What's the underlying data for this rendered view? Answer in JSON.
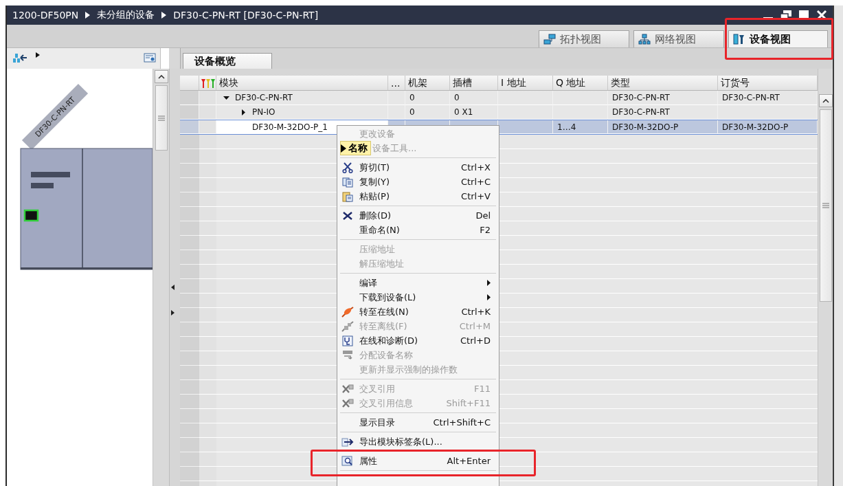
{
  "window": {
    "breadcrumb": [
      "1200-DF50PN",
      "未分组的设备",
      "DF30-C-PN-RT [DF30-C-PN-RT]"
    ]
  },
  "view_tabs": [
    {
      "label": "拓扑视图",
      "selected": false
    },
    {
      "label": "网络视图",
      "selected": false
    },
    {
      "label": "设备视图",
      "selected": true
    }
  ],
  "device_panel": {
    "device_label": "DF30-C-PN-RT"
  },
  "overview_tab": {
    "label": "设备概览",
    "selected": true
  },
  "table": {
    "columns": [
      "模块",
      "...",
      "机架",
      "插槽",
      "I 地址",
      "Q 地址",
      "类型",
      "订货号"
    ],
    "rows": [
      {
        "module": "DF30-C-PN-RT",
        "expanded": true,
        "selected": false,
        "rack": "0",
        "slot": "0",
        "type": "DF30-C-PN-RT",
        "order_no": "DF30-C-PN-RT",
        "children": [
          {
            "module": "PN-IO",
            "expanded": false,
            "selected": false,
            "rack": "0",
            "slot": "0 X1",
            "type": "DF30-C-PN-RT"
          },
          {
            "module": "DF30-M-32DO-P_1",
            "selected": true,
            "q_address": "1…4",
            "type": "DF30-M-32DO-P",
            "order_no": "DF30-M-32DO-P"
          }
        ]
      }
    ]
  },
  "context_menu": {
    "items": [
      {
        "kind": "item",
        "label": "更改设备",
        "disabled": true
      },
      {
        "kind": "item",
        "label": "设备工具...",
        "disabled": true,
        "tooltip": "名称"
      },
      {
        "kind": "separator"
      },
      {
        "kind": "item",
        "label": "剪切(T)",
        "shortcut": "Ctrl+X",
        "disabled": false
      },
      {
        "kind": "item",
        "label": "复制(Y)",
        "shortcut": "Ctrl+C",
        "disabled": false
      },
      {
        "kind": "item",
        "label": "粘贴(P)",
        "shortcut": "Ctrl+V",
        "disabled": false
      },
      {
        "kind": "separator"
      },
      {
        "kind": "item",
        "label": "删除(D)",
        "shortcut": "Del",
        "disabled": false
      },
      {
        "kind": "item",
        "label": "重命名(N)",
        "shortcut": "F2",
        "disabled": false
      },
      {
        "kind": "separator"
      },
      {
        "kind": "item",
        "label": "压缩地址",
        "disabled": true
      },
      {
        "kind": "item",
        "label": "解压缩地址",
        "disabled": true
      },
      {
        "kind": "separator"
      },
      {
        "kind": "item",
        "label": "编译",
        "submenu": true,
        "disabled": false
      },
      {
        "kind": "item",
        "label": "下载到设备(L)",
        "submenu": true,
        "disabled": false
      },
      {
        "kind": "item",
        "label": "转至在线(N)",
        "shortcut": "Ctrl+K",
        "disabled": false
      },
      {
        "kind": "item",
        "label": "转至离线(F)",
        "shortcut": "Ctrl+M",
        "disabled": true
      },
      {
        "kind": "item",
        "label": "在线和诊断(D)",
        "shortcut": "Ctrl+D",
        "disabled": false
      },
      {
        "kind": "item",
        "label": "分配设备名称",
        "disabled": true
      },
      {
        "kind": "item",
        "label": "更新并显示强制的操作数",
        "disabled": true
      },
      {
        "kind": "separator"
      },
      {
        "kind": "item",
        "label": "交叉引用",
        "shortcut": "F11",
        "disabled": true
      },
      {
        "kind": "item",
        "label": "交叉引用信息",
        "shortcut": "Shift+F11",
        "disabled": true
      },
      {
        "kind": "separator"
      },
      {
        "kind": "item",
        "label": "显示目录",
        "shortcut": "Ctrl+Shift+C",
        "disabled": false
      },
      {
        "kind": "separator"
      },
      {
        "kind": "item",
        "label": "导出模块标签条(L)...",
        "disabled": false
      },
      {
        "kind": "separator"
      },
      {
        "kind": "item",
        "label": "属性",
        "shortcut": "Alt+Enter",
        "disabled": false
      },
      {
        "kind": "separator"
      }
    ]
  }
}
